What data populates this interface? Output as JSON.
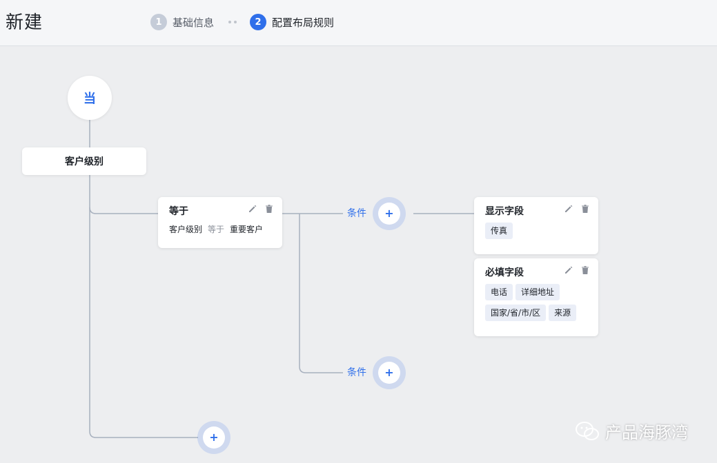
{
  "header": {
    "title": "新建",
    "steps": [
      {
        "number": "1",
        "label": "基础信息",
        "state": "inactive"
      },
      {
        "number": "2",
        "label": "配置布局规则",
        "state": "active"
      }
    ]
  },
  "flow": {
    "start_label": "当",
    "field_label": "客户级别",
    "condition_card": {
      "title": "等于",
      "field": "客户级别",
      "operator": "等于",
      "value": "重要客户"
    },
    "branch_labels": [
      "条件",
      "条件"
    ],
    "add_symbol": "+",
    "show_card": {
      "title": "显示字段",
      "tags": [
        "传真"
      ]
    },
    "required_card": {
      "title": "必填字段",
      "tags": [
        "电话",
        "详细地址",
        "国家/省/市/区",
        "来源"
      ]
    }
  },
  "watermark": {
    "text": "产品海豚湾"
  },
  "colors": {
    "accent": "#2f6fea",
    "connector": "#a7b0be",
    "canvas": "#edeef0",
    "tag_bg": "#eaeef7"
  },
  "icons": [
    "pencil-icon",
    "trash-icon",
    "plus-icon",
    "wechat-icon"
  ]
}
